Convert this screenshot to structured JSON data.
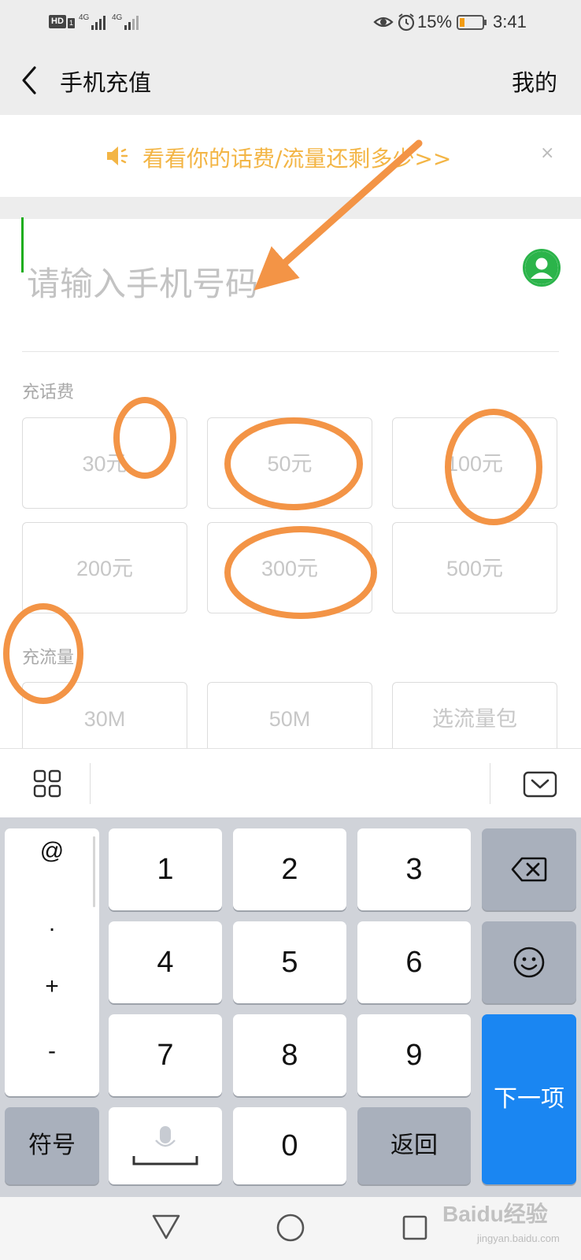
{
  "status_bar": {
    "hd": "HD",
    "sim": "1",
    "net1": "4G",
    "net2": "4G",
    "battery": "15%",
    "time": "3:41"
  },
  "header": {
    "title": "手机充值",
    "mine": "我的"
  },
  "notice": {
    "text": "看看你的话费/流量还剩多少>>",
    "close": "×"
  },
  "phone": {
    "placeholder": "请输入手机号码"
  },
  "recharge": {
    "label": "充话费",
    "amounts": [
      "30元",
      "50元",
      "100元",
      "200元",
      "300元",
      "500元"
    ]
  },
  "data_plan": {
    "label": "充流量",
    "options": [
      "30M",
      "50M",
      "选流量包"
    ]
  },
  "keyboard": {
    "side": [
      "@",
      ".",
      "+",
      "-"
    ],
    "digits": [
      "1",
      "2",
      "3",
      "4",
      "5",
      "6",
      "7",
      "8",
      "9",
      "0"
    ],
    "symbol": "符号",
    "back": "返回",
    "next": "下一项"
  },
  "watermark": {
    "brand": "Baidu经验",
    "url": "jingyan.baidu.com"
  },
  "colors": {
    "accent_green": "#1aad19",
    "notice_orange": "#f3b545",
    "key_blue": "#1a86f2",
    "annotation_orange": "#f39446"
  }
}
